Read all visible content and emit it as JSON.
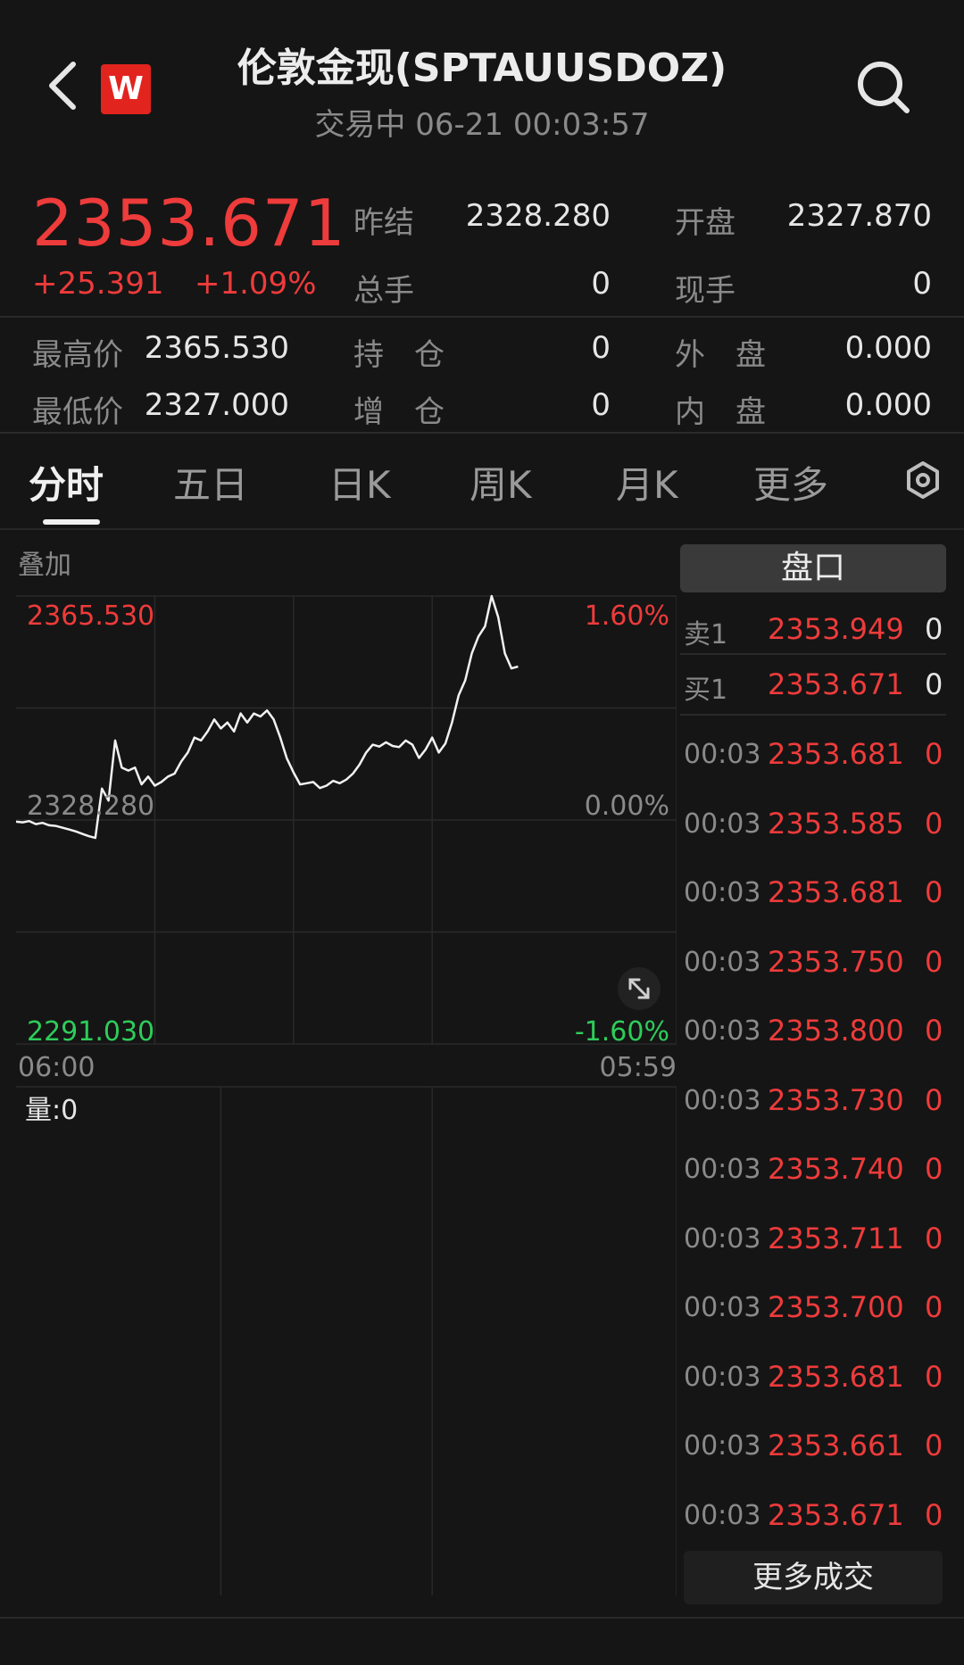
{
  "header": {
    "title": "伦敦金现(SPTAUUSDOZ)",
    "subtitle": "交易中 06-21 00:03:57",
    "logo": "W"
  },
  "quote": {
    "price": "2353.671",
    "change": "+25.391",
    "change_pct": "+1.09%",
    "stats": [
      {
        "label": "昨结",
        "value": "2328.280"
      },
      {
        "label": "开盘",
        "value": "2327.870"
      },
      {
        "label": "总手",
        "value": "0"
      },
      {
        "label": "现手",
        "value": "0"
      },
      {
        "label": "最高价",
        "value": "2365.530"
      },
      {
        "label": "持　仓",
        "value": "0"
      },
      {
        "label": "外　盘",
        "value": "0.000"
      },
      {
        "label": "最低价",
        "value": "2327.000"
      },
      {
        "label": "增　仓",
        "value": "0"
      },
      {
        "label": "内　盘",
        "value": "0.000"
      }
    ]
  },
  "tabs": [
    "分时",
    "五日",
    "日K",
    "周K",
    "月K",
    "更多"
  ],
  "overlay_label": "叠加",
  "chart_data": {
    "type": "line",
    "ylim": [
      2291.03,
      2365.53
    ],
    "baseline": 2328.28,
    "y_tick_labels": {
      "top": "2365.530",
      "mid": "2328.280",
      "bottom": "2291.030"
    },
    "pct_labels": {
      "top": "1.60%",
      "mid": "0.00%",
      "bottom": "-1.60%"
    },
    "x_tick_labels": [
      "06:00",
      "05:59"
    ],
    "x": [
      0,
      0.01,
      0.02,
      0.03,
      0.04,
      0.05,
      0.06,
      0.07,
      0.08,
      0.09,
      0.1,
      0.11,
      0.12,
      0.13,
      0.14,
      0.15,
      0.16,
      0.17,
      0.18,
      0.19,
      0.2,
      0.21,
      0.22,
      0.23,
      0.24,
      0.25,
      0.26,
      0.27,
      0.28,
      0.29,
      0.3,
      0.31,
      0.32,
      0.33,
      0.34,
      0.35,
      0.36,
      0.37,
      0.38,
      0.39,
      0.4,
      0.41,
      0.42,
      0.43,
      0.44,
      0.45,
      0.46,
      0.47,
      0.48,
      0.49,
      0.5,
      0.51,
      0.52,
      0.53,
      0.54,
      0.55,
      0.56,
      0.57,
      0.58,
      0.59,
      0.6,
      0.61,
      0.62,
      0.63,
      0.64,
      0.65,
      0.66,
      0.67,
      0.68,
      0.69,
      0.7,
      0.71,
      0.72,
      0.73,
      0.74,
      0.75,
      0.76
    ],
    "values": [
      2328.0,
      2327.9,
      2328.1,
      2327.6,
      2327.8,
      2327.4,
      2327.3,
      2327.0,
      2326.7,
      2326.4,
      2326.0,
      2325.6,
      2325.3,
      2333.5,
      2331.5,
      2341.5,
      2337.0,
      2336.5,
      2337.0,
      2334.2,
      2335.5,
      2334.0,
      2334.6,
      2335.5,
      2336.0,
      2338.0,
      2339.5,
      2342.0,
      2341.5,
      2343.0,
      2345.0,
      2343.5,
      2344.5,
      2343.0,
      2346.0,
      2344.5,
      2346.0,
      2345.5,
      2346.5,
      2345.0,
      2342.0,
      2338.5,
      2336.2,
      2334.2,
      2334.4,
      2334.6,
      2333.6,
      2334.0,
      2334.8,
      2334.4,
      2335.0,
      2336.0,
      2337.5,
      2339.5,
      2340.8,
      2340.5,
      2341.2,
      2340.6,
      2340.4,
      2341.5,
      2340.8,
      2338.6,
      2340.0,
      2342.0,
      2339.5,
      2341.0,
      2344.5,
      2349.0,
      2351.5,
      2356.0,
      2358.8,
      2360.5,
      2365.53,
      2362.0,
      2356.0,
      2353.5,
      2353.8
    ],
    "volume_label": "量:0"
  },
  "orderbook": {
    "title": "盘口",
    "levels": [
      {
        "label": "卖1",
        "price": "2353.949",
        "vol": "0"
      },
      {
        "label": "买1",
        "price": "2353.671",
        "vol": "0"
      }
    ],
    "ticks": [
      {
        "time": "00:03",
        "price": "2353.681",
        "vol": "0"
      },
      {
        "time": "00:03",
        "price": "2353.585",
        "vol": "0"
      },
      {
        "time": "00:03",
        "price": "2353.681",
        "vol": "0"
      },
      {
        "time": "00:03",
        "price": "2353.750",
        "vol": "0"
      },
      {
        "time": "00:03",
        "price": "2353.800",
        "vol": "0"
      },
      {
        "time": "00:03",
        "price": "2353.730",
        "vol": "0"
      },
      {
        "time": "00:03",
        "price": "2353.740",
        "vol": "0"
      },
      {
        "time": "00:03",
        "price": "2353.711",
        "vol": "0"
      },
      {
        "time": "00:03",
        "price": "2353.700",
        "vol": "0"
      },
      {
        "time": "00:03",
        "price": "2353.681",
        "vol": "0"
      },
      {
        "time": "00:03",
        "price": "2353.661",
        "vol": "0"
      },
      {
        "time": "00:03",
        "price": "2353.671",
        "vol": "0"
      }
    ],
    "more_label": "更多成交"
  },
  "colors": {
    "up": "#ee3b3b",
    "down": "#2ecc5a",
    "bg": "#151515"
  }
}
